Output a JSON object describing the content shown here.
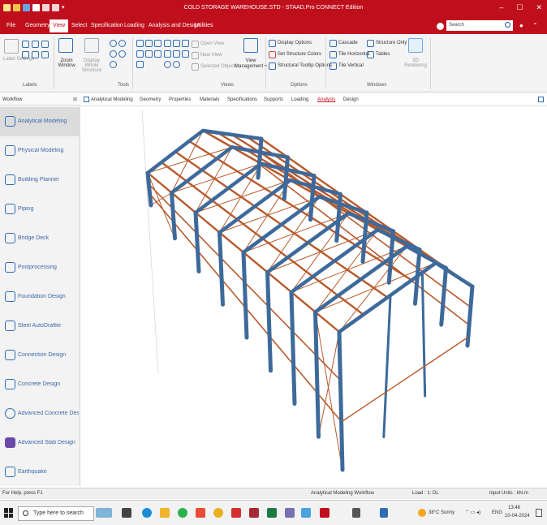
{
  "window": {
    "title": "COLD STORAGE WAREHOUSE.STD - STAAD.Pro CONNECT Edition"
  },
  "menu": {
    "items": [
      "File",
      "Geometry",
      "View",
      "Select",
      "Specification",
      "Loading",
      "Analysis and Design",
      "Utilities"
    ],
    "active": "View",
    "search_placeholder": "Search"
  },
  "ribbon": {
    "labels_group": {
      "label": "Labels",
      "label_settings": "Label Settings"
    },
    "tools_group": {
      "label": "Tools",
      "zoom_window": "Zoom Window",
      "display_whole_structure": "Display Whole Structure"
    },
    "views_group": {
      "label": "Views",
      "open_view": "Open View",
      "new_view": "New View",
      "selected_objects": "Selected Objects",
      "view_management": "View Management"
    },
    "options_group": {
      "label": "Options",
      "display_options": "Display Options",
      "set_structure_colors": "Set Structure Colors",
      "structural_tooltip_options": "Structural Tooltip Options"
    },
    "windows_group": {
      "label": "Windows",
      "cascade": "Cascade",
      "tile_horizontal": "Tile Horizontal",
      "tile_vertical": "Tile Vertical",
      "structure_only": "Structure Only",
      "tables": "Tables",
      "rendering_3d": "3D Rendering"
    }
  },
  "workflow": {
    "header": "Workflow",
    "items": [
      {
        "label": "Analytical Modeling",
        "selected": true
      },
      {
        "label": "Physical Modeling"
      },
      {
        "label": "Building Planner"
      },
      {
        "label": "Piping"
      },
      {
        "label": "Bridge Deck"
      },
      {
        "label": "Postprocessing"
      },
      {
        "label": "Foundation Design"
      },
      {
        "label": "Steel AutoDrafter"
      },
      {
        "label": "Connection Design"
      },
      {
        "label": "Concrete Design"
      },
      {
        "label": "Advanced Concrete Desi..."
      },
      {
        "label": "Advanced Slab Design"
      },
      {
        "label": "Earthquake"
      }
    ]
  },
  "page_tabs": {
    "items": [
      "Analytical Modeling",
      "Geometry",
      "Properties",
      "Materials",
      "Specifications",
      "Supports",
      "Loading",
      "Analysis",
      "Design"
    ],
    "active": "Analysis"
  },
  "colors": {
    "accent": "#c00f1c",
    "column": "#3d6a9a",
    "beam": "#b85a2c"
  },
  "status": {
    "help": "For Help, press F1",
    "workflow": "Analytical Modeling Workflow",
    "load": "Load : 1: DL",
    "input_units": "Input Units : kN-m"
  },
  "taskbar": {
    "search_text": "Type here to search",
    "weather": "38°C  Sunny",
    "language": "ENG",
    "time": "13:46",
    "date": "10-04-2024"
  }
}
